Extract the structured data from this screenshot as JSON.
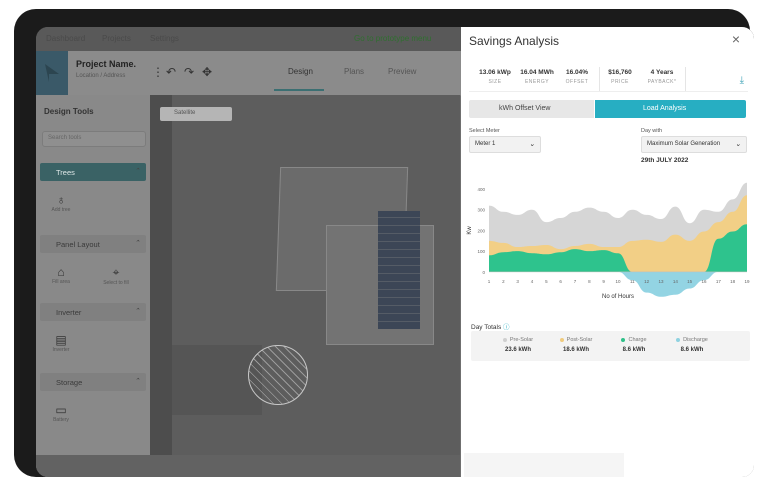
{
  "topnav": {
    "items": [
      "Dashboard",
      "Projects",
      "Settings"
    ],
    "notice": "Go to prototype menu"
  },
  "toolbar": {
    "project_name": "Project Name.",
    "project_sub": "Location / Address",
    "tabs": [
      "Design",
      "Plans",
      "Preview"
    ]
  },
  "sidebar": {
    "title": "Design Tools",
    "search_placeholder": "Search tools",
    "sections": [
      "Trees",
      "Panel Layout",
      "Inverter",
      "Storage"
    ],
    "tools": [
      "Add tree",
      "Fill area",
      "Select to fill",
      "Inverter",
      "Battery"
    ]
  },
  "map": {
    "view_label": "Satellite"
  },
  "panel": {
    "title": "Savings Analysis",
    "close": "×",
    "stats": [
      {
        "value": "13.06 kWp",
        "label": "SIZE"
      },
      {
        "value": "16.04 MWh",
        "label": "ENERGY"
      },
      {
        "value": "16.04%",
        "label": "OFFSET"
      },
      {
        "value": "$16,760",
        "label": "PRICE"
      },
      {
        "value": "4 Years",
        "label": "PAYBACK*"
      }
    ],
    "tabs": [
      "kWh Offset View",
      "Load Analysis"
    ],
    "select_meter_label": "Select Meter",
    "meter_value": "Meter 1",
    "day_with_label": "Day with",
    "day_with_value": "Maximum Solar Generation",
    "date": "29th JULY 2022",
    "totals_title": "Day Totals",
    "totals": [
      {
        "name": "Pre-Solar",
        "value": "23.6 kWh",
        "color": "#cfcfcf"
      },
      {
        "name": "Post-Solar",
        "value": "18.6 kWh",
        "color": "#f0cb7e"
      },
      {
        "name": "Charge",
        "value": "8.6 kWh",
        "color": "#2fc089"
      },
      {
        "name": "Discharge",
        "value": "8.6 kWh",
        "color": "#8fd2e0"
      }
    ]
  },
  "chart_data": {
    "type": "area",
    "xlabel": "No of Hours",
    "ylabel": "Kw",
    "x": [
      1,
      2,
      3,
      4,
      5,
      6,
      7,
      8,
      9,
      10,
      11,
      12,
      13,
      14,
      15,
      16,
      17,
      18,
      19
    ],
    "ylim": [
      -150,
      400
    ],
    "yticks": [
      0,
      100,
      200,
      300,
      400
    ],
    "series": [
      {
        "name": "Pre-Solar",
        "color": "#d6d6d6",
        "values": [
          320,
          290,
          275,
          300,
          240,
          260,
          290,
          310,
          290,
          260,
          300,
          275,
          255,
          315,
          235,
          300,
          290,
          350,
          430
        ]
      },
      {
        "name": "Post-Solar",
        "color": "#f2cf86",
        "values": [
          150,
          140,
          120,
          125,
          130,
          110,
          125,
          135,
          120,
          120,
          150,
          155,
          145,
          180,
          150,
          195,
          240,
          290,
          370
        ]
      },
      {
        "name": "Charge",
        "color": "#2ec38d",
        "values": [
          80,
          95,
          100,
          90,
          85,
          95,
          110,
          100,
          105,
          90,
          0,
          0,
          0,
          0,
          0,
          0,
          160,
          195,
          230
        ]
      },
      {
        "name": "Discharge",
        "color": "#93d4e3",
        "values": [
          0,
          0,
          0,
          0,
          0,
          0,
          0,
          0,
          0,
          0,
          -40,
          -100,
          -120,
          -110,
          -80,
          -40,
          0,
          0,
          0
        ]
      }
    ]
  }
}
